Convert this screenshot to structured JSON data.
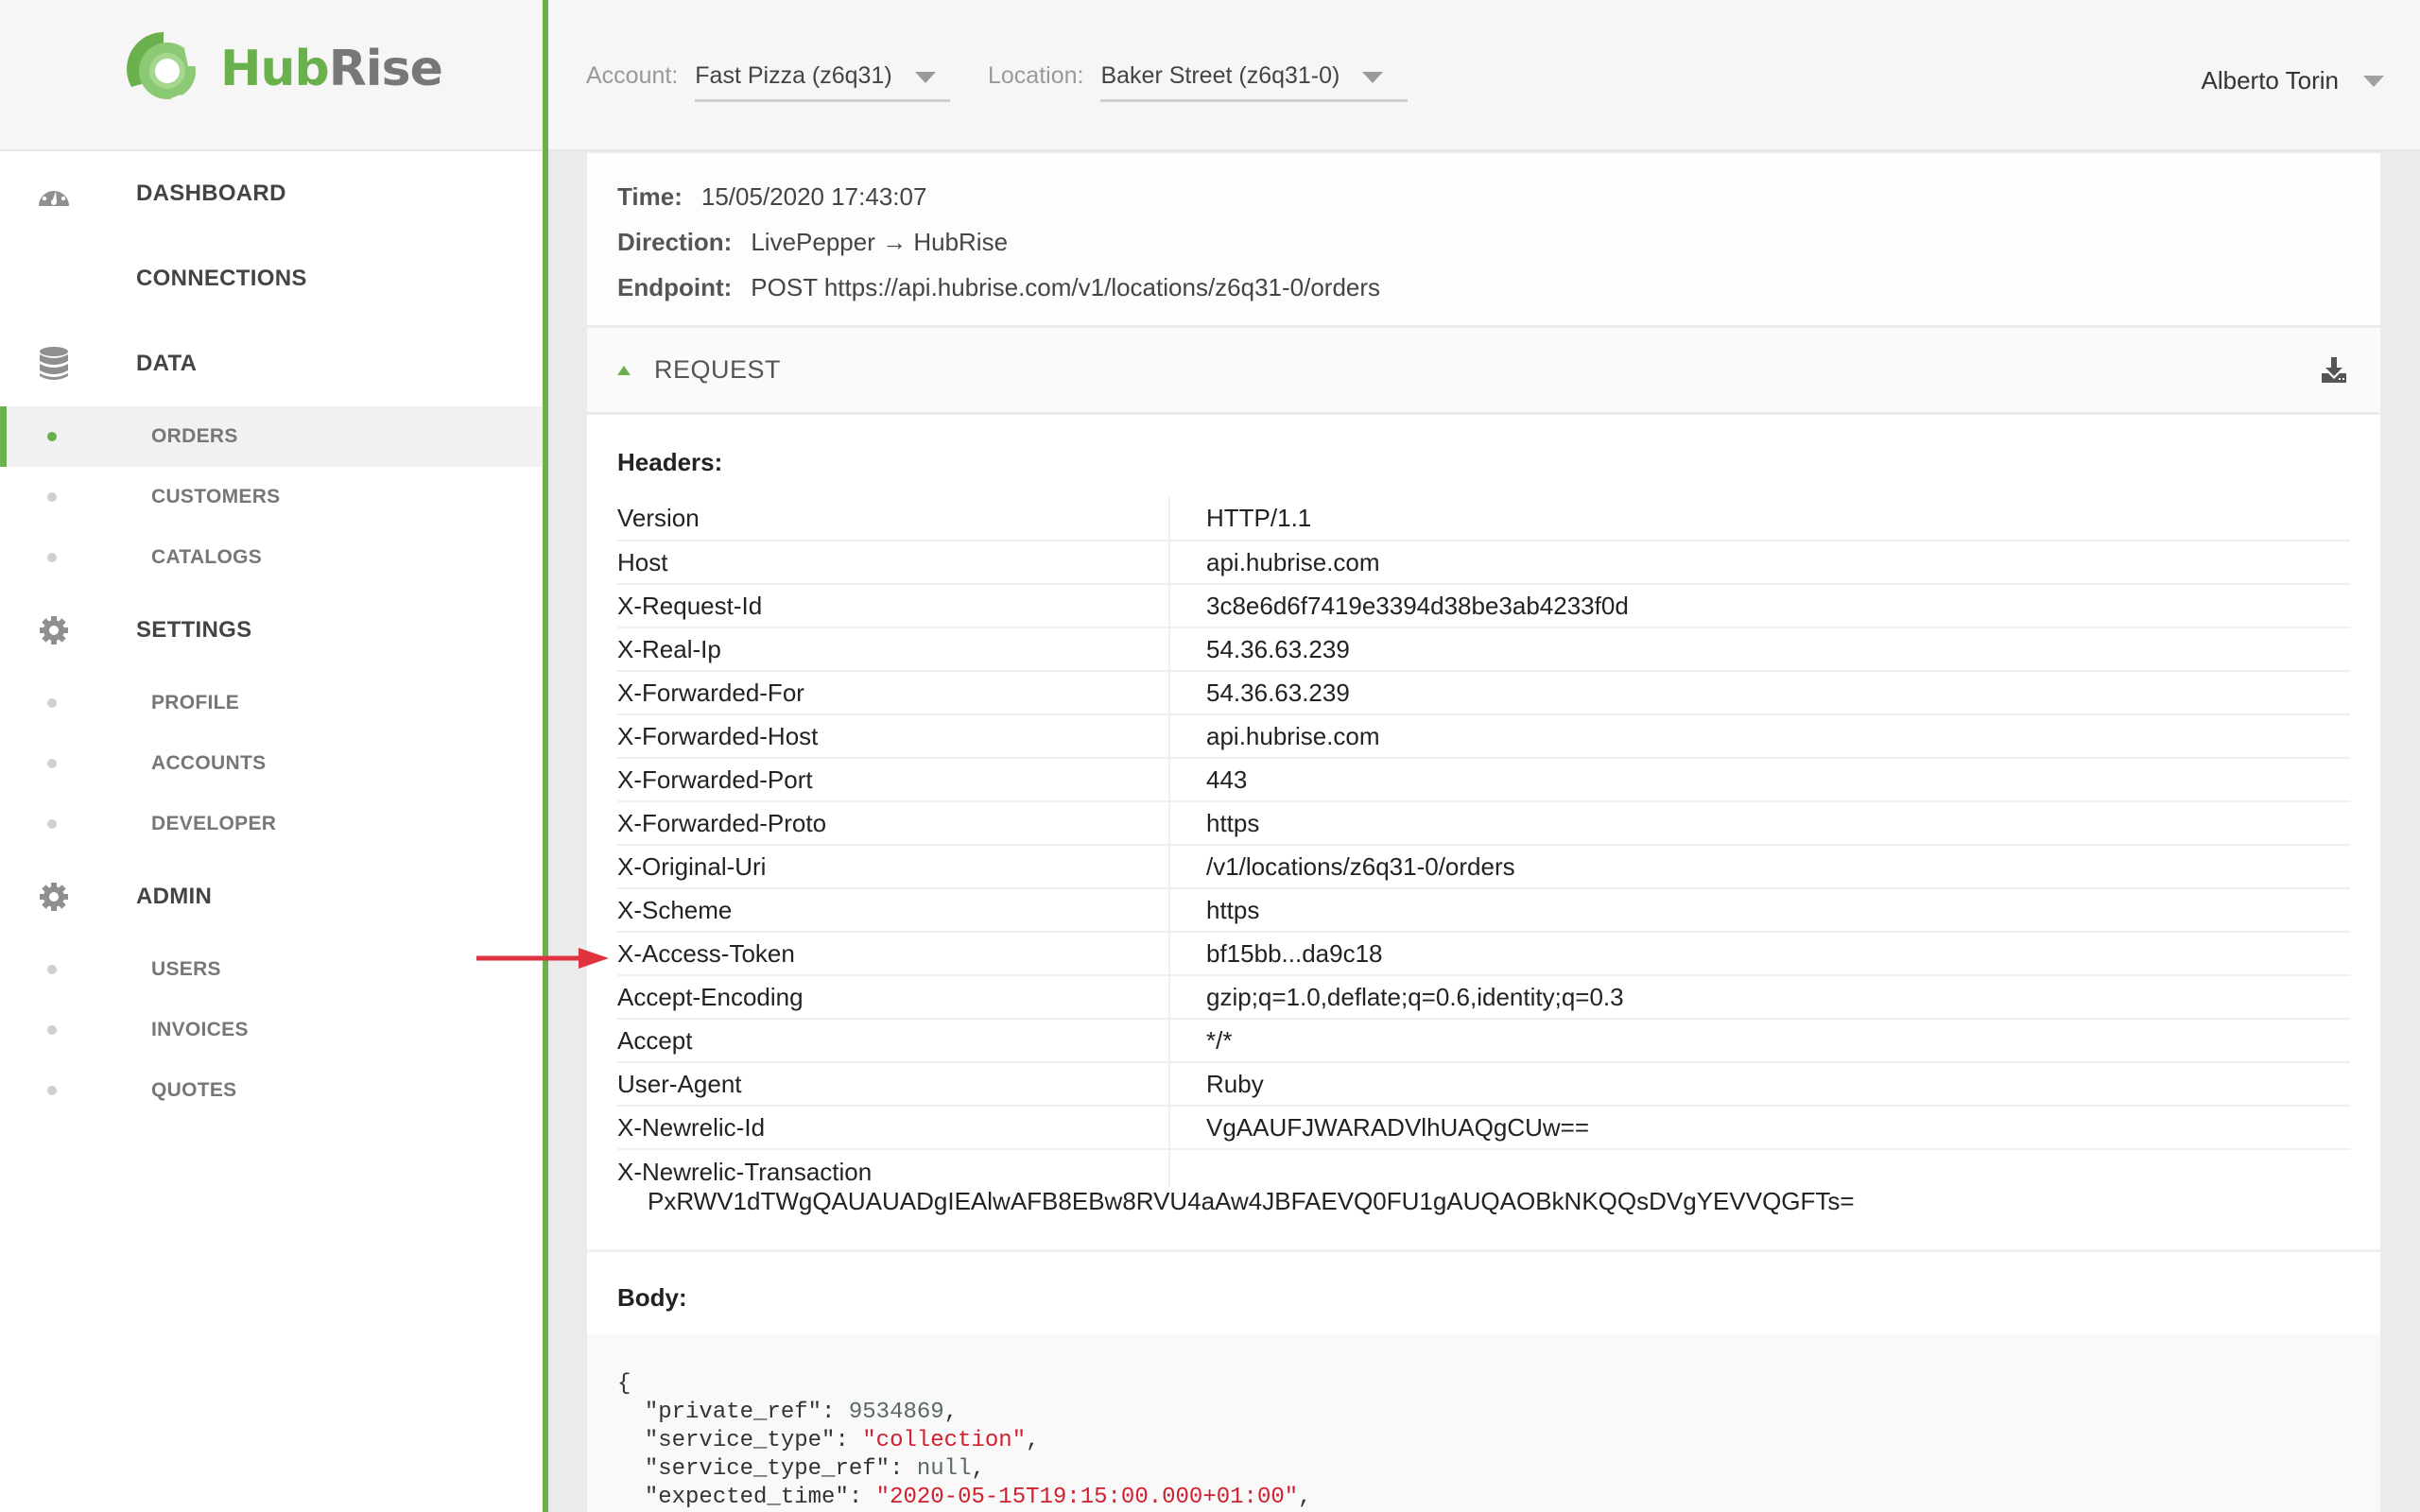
{
  "brand": {
    "name_part1": "Hub",
    "name_part2": "Rise",
    "accent_color": "#6ab04c"
  },
  "sidebar": {
    "sections": [
      {
        "label": "DASHBOARD",
        "icon": "dashboard-icon"
      },
      {
        "label": "CONNECTIONS",
        "icon": null
      },
      {
        "label": "DATA",
        "icon": "database-icon",
        "items": [
          {
            "label": "ORDERS",
            "active": true
          },
          {
            "label": "CUSTOMERS",
            "active": false
          },
          {
            "label": "CATALOGS",
            "active": false
          }
        ]
      },
      {
        "label": "SETTINGS",
        "icon": "gear-icon",
        "items": [
          {
            "label": "PROFILE",
            "active": false
          },
          {
            "label": "ACCOUNTS",
            "active": false
          },
          {
            "label": "DEVELOPER",
            "active": false
          }
        ]
      },
      {
        "label": "ADMIN",
        "icon": "gear-icon",
        "items": [
          {
            "label": "USERS",
            "active": false
          },
          {
            "label": "INVOICES",
            "active": false
          },
          {
            "label": "QUOTES",
            "active": false
          }
        ]
      }
    ]
  },
  "topbar": {
    "account_label": "Account:",
    "account_value": "Fast Pizza (z6q31)",
    "location_label": "Location:",
    "location_value": "Baker Street (z6q31-0)",
    "user_name": "Alberto Torin"
  },
  "log": {
    "time_label": "Time:",
    "time_value": "15/05/2020 17:43:07",
    "direction_label": "Direction:",
    "direction_value": "LivePepper → HubRise",
    "endpoint_label": "Endpoint:",
    "endpoint_value": "POST https://api.hubrise.com/v1/locations/z6q31-0/orders"
  },
  "request": {
    "title": "REQUEST",
    "headers_title": "Headers:",
    "headers": [
      {
        "key": "Version",
        "value": "HTTP/1.1"
      },
      {
        "key": "Host",
        "value": "api.hubrise.com"
      },
      {
        "key": "X-Request-Id",
        "value": "3c8e6d6f7419e3394d38be3ab4233f0d"
      },
      {
        "key": "X-Real-Ip",
        "value": "54.36.63.239"
      },
      {
        "key": "X-Forwarded-For",
        "value": "54.36.63.239"
      },
      {
        "key": "X-Forwarded-Host",
        "value": "api.hubrise.com"
      },
      {
        "key": "X-Forwarded-Port",
        "value": "443"
      },
      {
        "key": "X-Forwarded-Proto",
        "value": "https"
      },
      {
        "key": "X-Original-Uri",
        "value": "/v1/locations/z6q31-0/orders"
      },
      {
        "key": "X-Scheme",
        "value": "https"
      },
      {
        "key": "X-Access-Token",
        "value": "bf15bb...da9c18",
        "highlighted": true
      },
      {
        "key": "Accept-Encoding",
        "value": "gzip;q=1.0,deflate;q=0.6,identity;q=0.3"
      },
      {
        "key": "Accept",
        "value": "*/*"
      },
      {
        "key": "User-Agent",
        "value": "Ruby"
      },
      {
        "key": "X-Newrelic-Id",
        "value": "VgAAUFJWARADVlhUAQgCUw=="
      },
      {
        "key": "X-Newrelic-Transaction",
        "value": "PxRWV1dTWgQAUAUADgIEAlwAFB8EBw8RVU4aAw4JBFAEVQ0FU1gAUQAOBkNKQQsDVgYEVVQGFTs="
      }
    ],
    "body_title": "Body:",
    "body_lines": [
      {
        "open": "{"
      },
      {
        "key": "\"private_ref\"",
        "value": "9534869",
        "type": "num"
      },
      {
        "key": "\"service_type\"",
        "value": "\"collection\"",
        "type": "str"
      },
      {
        "key": "\"service_type_ref\"",
        "value": "null",
        "type": "nul"
      },
      {
        "key": "\"expected_time\"",
        "value": "\"2020-05-15T19:15:00.000+01:00\"",
        "type": "str"
      }
    ]
  },
  "annotation": {
    "arrow_color": "#e03340",
    "points_to": "X-Access-Token"
  }
}
